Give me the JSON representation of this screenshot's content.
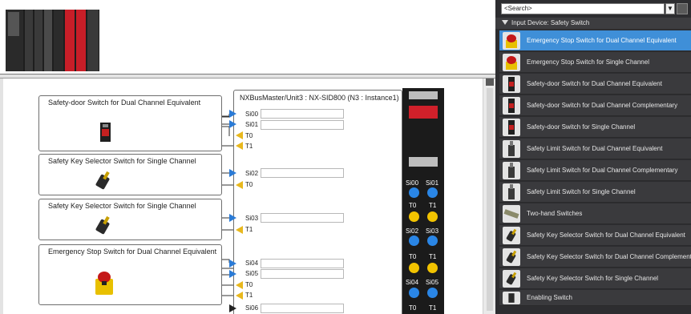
{
  "colors": {
    "selection": "#3f8fd8",
    "input_port": "#2b7bd6",
    "output_port": "#e8b81e",
    "led_blue": "#2a86e6",
    "led_yellow": "#f2c300",
    "unit_red": "#d0202a"
  },
  "canvas": {
    "devices": [
      {
        "title": "Safety-door Switch for Dual Channel Equivalent",
        "icon": "door-switch-icon"
      },
      {
        "title": "Safety Key Selector Switch for Single Channel",
        "icon": "key-selector-icon"
      },
      {
        "title": "Safety Key Selector Switch for Single Channel",
        "icon": "key-selector-icon"
      },
      {
        "title": "Emergency Stop Switch for Dual Channel Equivalent",
        "icon": "emergency-stop-icon"
      }
    ],
    "controller": {
      "title": "NXBusMaster/Unit3 : NX-SID800 (N3 : Instance1)",
      "ports": [
        "Si00",
        "Si01",
        "T0",
        "T1",
        "Si02",
        "T0",
        "Si03",
        "T1",
        "Si04",
        "Si05",
        "T0",
        "T1",
        "Si06"
      ]
    },
    "unit_leds": [
      {
        "labels": [
          "Si00",
          "Si01"
        ],
        "color": "blue"
      },
      {
        "labels": [
          "T0",
          "T1"
        ],
        "color": "yellow"
      },
      {
        "labels": [
          "Si02",
          "Si03"
        ],
        "color": "blue"
      },
      {
        "labels": [
          "T0",
          "T1"
        ],
        "color": "yellow"
      },
      {
        "labels": [
          "Si04",
          "Si05"
        ],
        "color": "blue"
      },
      {
        "labels": [
          "T0",
          "T1"
        ],
        "color": "yellow"
      }
    ]
  },
  "toolbox": {
    "search_value": "<Search>",
    "category": "Input Device: Safety Switch",
    "items": [
      {
        "label": "Emergency Stop Switch for Dual Channel Equivalent",
        "icon": "emergency-stop-icon",
        "selected": true
      },
      {
        "label": "Emergency Stop Switch for Single Channel",
        "icon": "emergency-stop-icon",
        "selected": false
      },
      {
        "label": "Safety-door Switch for Dual Channel Equivalent",
        "icon": "door-switch-icon",
        "selected": false
      },
      {
        "label": "Safety-door Switch for Dual Channel Complementary",
        "icon": "door-switch-icon",
        "selected": false
      },
      {
        "label": "Safety-door Switch for Single Channel",
        "icon": "door-switch-icon",
        "selected": false
      },
      {
        "label": "Safety Limit Switch for Dual Channel Equivalent",
        "icon": "limit-switch-icon",
        "selected": false
      },
      {
        "label": "Safety Limit Switch for Dual Channel Complementary",
        "icon": "limit-switch-icon",
        "selected": false
      },
      {
        "label": "Safety Limit Switch for Single Channel",
        "icon": "limit-switch-icon",
        "selected": false
      },
      {
        "label": "Two-hand Switches",
        "icon": "two-hand-switch-icon",
        "selected": false
      },
      {
        "label": "Safety Key Selector Switch for Dual Channel Equivalent",
        "icon": "key-selector-icon",
        "selected": false
      },
      {
        "label": "Safety Key Selector Switch for Dual Channel Complementary",
        "icon": "key-selector-icon",
        "selected": false
      },
      {
        "label": "Safety Key Selector Switch for Single Channel",
        "icon": "key-selector-icon",
        "selected": false
      },
      {
        "label": "Enabling Switch",
        "icon": "enabling-switch-icon",
        "selected": false
      }
    ]
  }
}
